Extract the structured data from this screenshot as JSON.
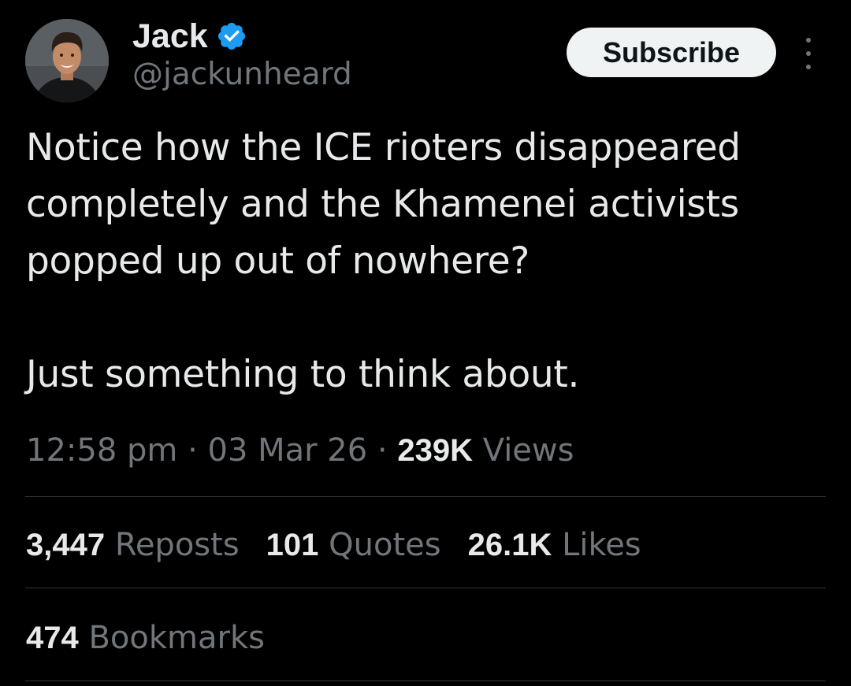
{
  "author": {
    "display_name": "Jack",
    "handle": "@jackunheard",
    "verified": true,
    "avatar": "avatar-photo"
  },
  "actions": {
    "subscribe_label": "Subscribe",
    "more_icon": "more-vertical-icon"
  },
  "tweet": {
    "paragraphs": [
      "Notice how the ICE rioters disappeared completely and the Khamenei activists popped up out of nowhere?",
      "Just something to think about."
    ]
  },
  "meta": {
    "time": "12:58 pm",
    "separator": "·",
    "date": "03 Mar 26",
    "views_count": "239K",
    "views_label": "Views"
  },
  "stats": [
    {
      "count": "3,447",
      "label": "Reposts"
    },
    {
      "count": "101",
      "label": "Quotes"
    },
    {
      "count": "26.1K",
      "label": "Likes"
    }
  ],
  "bookmarks": {
    "count": "474",
    "label": "Bookmarks"
  },
  "colors": {
    "background": "#000000",
    "primary_text": "#e7e9ea",
    "secondary_text": "#71767b",
    "verified_badge": "#1d9bf0",
    "subscribe_bg": "#eff3f4",
    "divider": "#2f3336"
  }
}
